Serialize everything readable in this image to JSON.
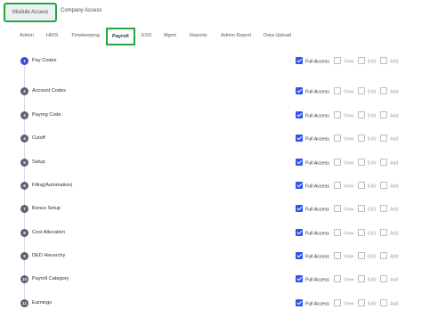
{
  "access_tabs": [
    "Module Access",
    "Company Access"
  ],
  "module_tabs": [
    "Admin",
    "HRIS",
    "Timekeeping",
    "Payroll",
    "ESS",
    "Mgmt",
    "Reports",
    "Admin Report",
    "Data Upload"
  ],
  "permission_labels": {
    "full": "Full Access",
    "view": "View",
    "edit": "Edit",
    "add": "Add"
  },
  "rows": [
    {
      "num": "1",
      "label": "Pay Codes",
      "full": true
    },
    {
      "num": "2",
      "label": "Account Codes",
      "full": true
    },
    {
      "num": "3",
      "label": "Payreg Code",
      "full": true
    },
    {
      "num": "4",
      "label": "Cutoff",
      "full": true
    },
    {
      "num": "5",
      "label": "Setup",
      "full": true
    },
    {
      "num": "6",
      "label": "Filing(Automation)",
      "full": true
    },
    {
      "num": "7",
      "label": "Bonus Setup",
      "full": true
    },
    {
      "num": "8",
      "label": "Cost Allocation",
      "full": true
    },
    {
      "num": "9",
      "label": "DED Hierarchy",
      "full": true
    },
    {
      "num": "10",
      "label": "Payroll Category",
      "full": true
    },
    {
      "num": "11",
      "label": "Earnings",
      "full": true
    }
  ]
}
